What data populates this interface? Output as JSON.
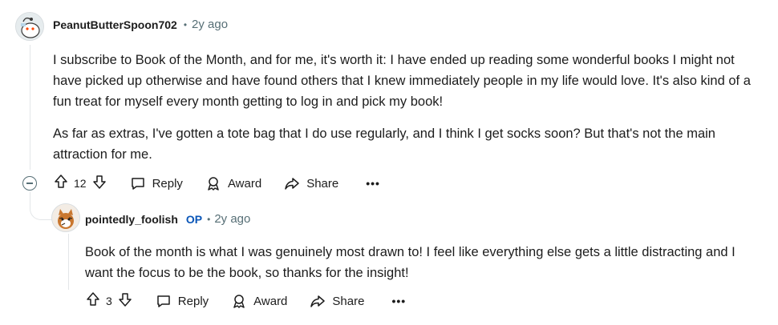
{
  "comment": {
    "username": "PeanutButterSpoon702",
    "time": "2y ago",
    "paragraphs": [
      "I subscribe to Book of the Month, and for me, it's worth it: I have ended up reading some wonderful books I might not have picked up otherwise and have found others that I knew immediately people in my life would love. It's also kind of a fun treat for myself every month getting to log in and pick my book!",
      "As far as extras, I've gotten a tote bag that I do use regularly, and I think I get socks soon? But that's not the main attraction for me."
    ],
    "votes": "12",
    "reply_label": "Reply",
    "award_label": "Award",
    "share_label": "Share",
    "more_label": "•••"
  },
  "reply": {
    "username": "pointedly_foolish",
    "op_badge": "OP",
    "time": "2y ago",
    "paragraphs": [
      "Book of the month is what I was genuinely most drawn to! I feel like everything else gets a little distracting and I want the focus to be the book, so thanks for the insight!"
    ],
    "votes": "3",
    "reply_label": "Reply",
    "award_label": "Award",
    "share_label": "Share",
    "more_label": "•••"
  },
  "meta_separator": "•"
}
